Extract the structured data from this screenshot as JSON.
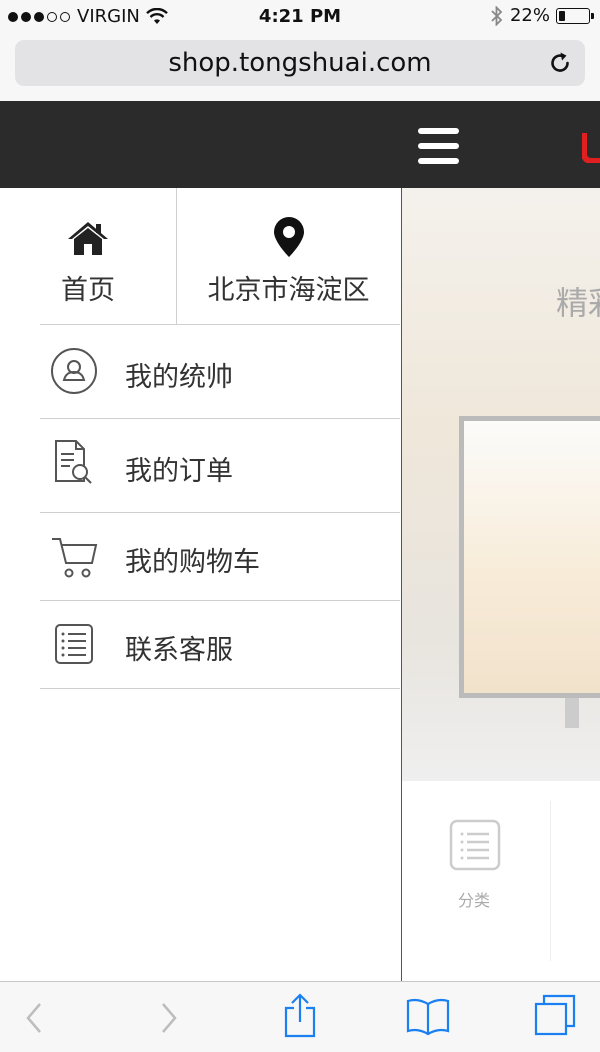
{
  "status_bar": {
    "carrier": "VIRGIN",
    "time": "4:21 PM",
    "battery": "22%",
    "battery_level": 0.22,
    "signal_bars_filled": 3,
    "signal_bars_total": 5
  },
  "browser": {
    "url": "shop.tongshuai.com"
  },
  "menu": {
    "home_label": "首页",
    "location_label": "北京市海淀区",
    "items": [
      {
        "label": "我的统帅",
        "icon": "user-icon"
      },
      {
        "label": "我的订单",
        "icon": "order-search-icon"
      },
      {
        "label": "我的购物车",
        "icon": "cart-icon"
      },
      {
        "label": "联系客服",
        "icon": "list-icon"
      }
    ]
  },
  "page": {
    "banner_text": "精彩",
    "category_label": "分类"
  },
  "colors": {
    "header_bg": "#2b2b2b",
    "brand_red": "#e02020",
    "ios_blue": "#1a7ff0"
  }
}
